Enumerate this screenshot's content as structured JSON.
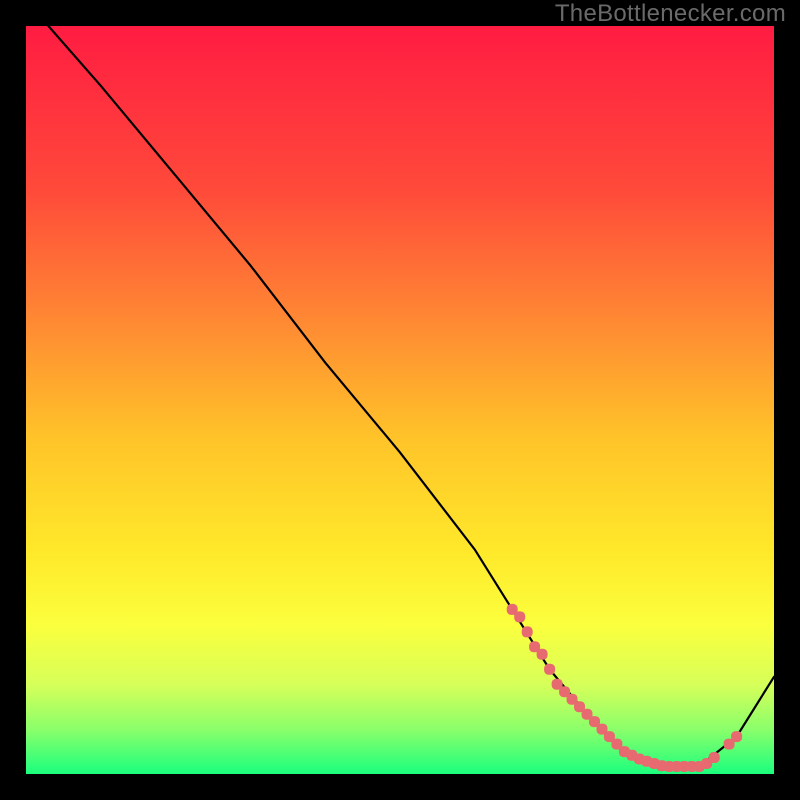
{
  "attribution": "TheBottlenecker.com",
  "chart_data": {
    "type": "line",
    "title": "",
    "xlabel": "",
    "ylabel": "",
    "xlim": [
      0,
      100
    ],
    "ylim": [
      0,
      100
    ],
    "series": [
      {
        "name": "curve",
        "x": [
          3,
          10,
          20,
          30,
          40,
          50,
          60,
          65,
          70,
          75,
          80,
          85,
          90,
          95,
          100
        ],
        "y": [
          100,
          92,
          80,
          68,
          55,
          43,
          30,
          22,
          14,
          8,
          3,
          1,
          1,
          5,
          13
        ]
      }
    ],
    "markers": {
      "name": "highlighted-range",
      "color": "#e66a6f",
      "x": [
        65,
        66,
        67,
        68,
        69,
        70,
        71,
        72,
        73,
        74,
        75,
        76,
        77,
        78,
        79,
        80,
        81,
        82,
        83,
        84,
        85,
        86,
        87,
        88,
        89,
        90,
        91,
        92,
        94,
        95
      ],
      "y": [
        22,
        21,
        19,
        17,
        16,
        14,
        12,
        11,
        10,
        9,
        8,
        7,
        6,
        5,
        4,
        3,
        2.5,
        2,
        1.7,
        1.4,
        1.1,
        1,
        1,
        1,
        1,
        1,
        1.4,
        2.2,
        4,
        5
      ]
    },
    "background_gradient": {
      "stops": [
        {
          "offset": 0.0,
          "color": "#ff1c42"
        },
        {
          "offset": 0.22,
          "color": "#ff4a3a"
        },
        {
          "offset": 0.4,
          "color": "#ff8b33"
        },
        {
          "offset": 0.55,
          "color": "#ffc329"
        },
        {
          "offset": 0.7,
          "color": "#ffe82a"
        },
        {
          "offset": 0.8,
          "color": "#fbff3d"
        },
        {
          "offset": 0.88,
          "color": "#d7ff59"
        },
        {
          "offset": 0.94,
          "color": "#8bff6a"
        },
        {
          "offset": 1.0,
          "color": "#1bff7e"
        }
      ]
    }
  }
}
